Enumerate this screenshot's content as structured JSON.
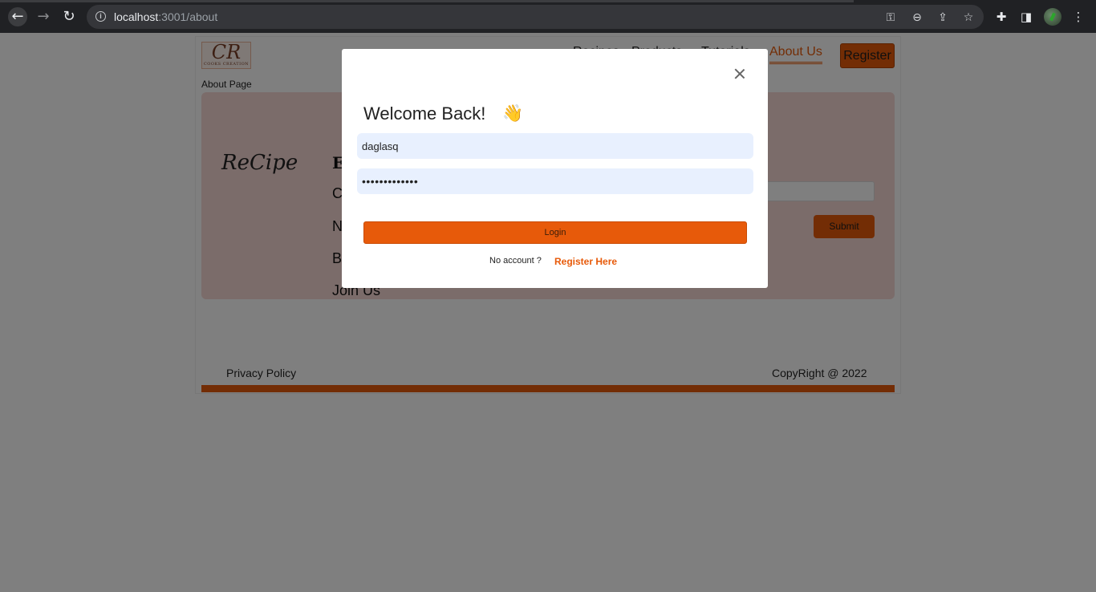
{
  "browser": {
    "url_host": "localhost",
    "url_path": ":3001/about",
    "icons": [
      "back-arrow-icon",
      "forward-arrow-icon",
      "reload-icon",
      "info-icon",
      "key-icon",
      "zoom-out-icon",
      "share-icon",
      "star-icon",
      "extensions-icon",
      "side-panel-icon",
      "profile-avatar",
      "menu-dots-icon"
    ]
  },
  "header": {
    "logo_text": "CR",
    "logo_subtext": "COOKS CREATION",
    "page_label": "About Page",
    "nav_items": [
      "Recipes",
      "Products",
      "Tutorials"
    ],
    "active_nav": "About Us",
    "register_label": "Register"
  },
  "footer": {
    "brand": "ReCipe",
    "heading_initial": "E",
    "links_initials": [
      "C",
      "N",
      "B"
    ],
    "join_link": "Join Us",
    "submit_label": "Submit",
    "privacy": "Privacy Policy",
    "copyright": "CopyRight @ 2022"
  },
  "modal": {
    "title": "Welcome Back!",
    "wave_glyph": "👋",
    "username_value": "daglasq",
    "password_value": "•••••••••••••",
    "login_label": "Login",
    "no_account_text": "No account ?",
    "register_link": "Register Here"
  },
  "colors": {
    "accent": "#e75a0a",
    "panel_bg": "#f7d8d4",
    "input_bg": "#e8f0fe"
  }
}
